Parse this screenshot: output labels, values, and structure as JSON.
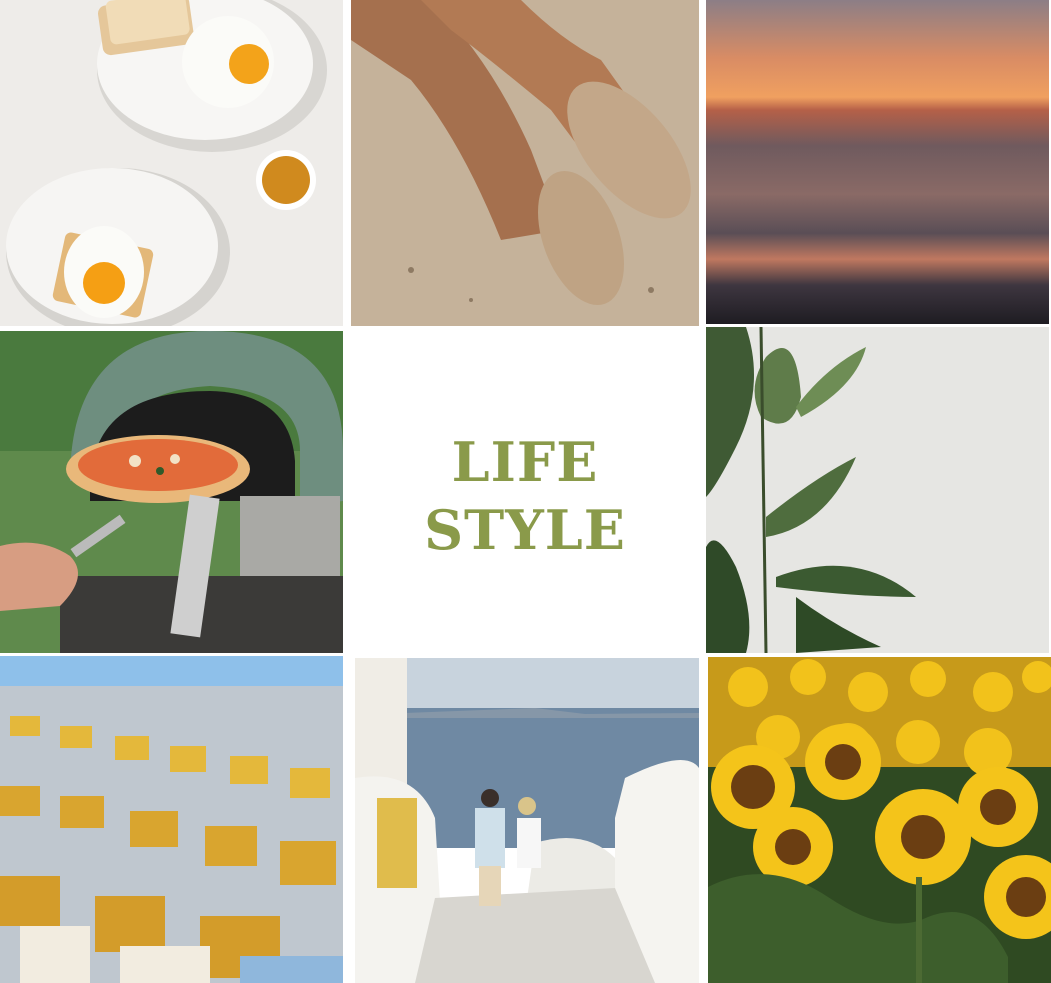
{
  "center": {
    "title_line1": "LIFE",
    "title_line2": "STYLE"
  },
  "colors": {
    "title": "#8a9a4a",
    "background": "#ffffff"
  },
  "photos": [
    {
      "name": "breakfast-eggs-photo"
    },
    {
      "name": "sandy-feet-photo"
    },
    {
      "name": "sunset-sea-photo"
    },
    {
      "name": "pizza-oven-photo"
    },
    {
      "name": "lifestyle-title-tile"
    },
    {
      "name": "rubber-plant-photo"
    },
    {
      "name": "geometric-architecture-photo"
    },
    {
      "name": "santorini-couple-photo"
    },
    {
      "name": "sunflower-field-photo"
    }
  ]
}
